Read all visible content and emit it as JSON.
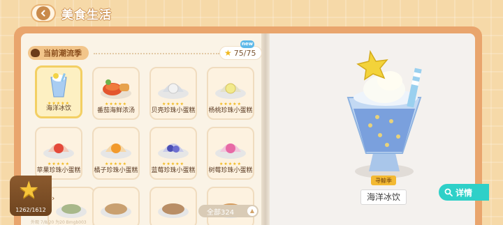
{
  "header": {
    "title": "美食生活",
    "back_icon": "chevron-left-icon"
  },
  "season": {
    "label": "当前潮流季",
    "icon": "pot-icon",
    "progress": "75/75",
    "progress_icon": "star-icon",
    "new_badge": "new"
  },
  "grid": {
    "items": [
      {
        "name": "海洋冰饮",
        "stars": "★★★★★",
        "selected": true,
        "dish": "drink"
      },
      {
        "name": "番茄海鲜浓汤",
        "stars": "★★★★★",
        "selected": false,
        "dish": "soup"
      },
      {
        "name": "贝壳珍珠小蛋糕",
        "stars": "★★★★★",
        "selected": false,
        "dish": "shell-white"
      },
      {
        "name": "杨桃珍珠小蛋糕",
        "stars": "★★★★★",
        "selected": false,
        "dish": "shell-yellow"
      },
      {
        "name": "苹果珍珠小蛋糕",
        "stars": "★★★★★",
        "selected": false,
        "dish": "shell-red"
      },
      {
        "name": "橘子珍珠小蛋糕",
        "stars": "★★★★★",
        "selected": false,
        "dish": "shell-orange"
      },
      {
        "name": "蓝莓珍珠小蛋糕",
        "stars": "★★★★★",
        "selected": false,
        "dish": "shell-blue"
      },
      {
        "name": "树莓珍珠小蛋糕",
        "stars": "★★★★★",
        "selected": false,
        "dish": "shell-pink"
      }
    ]
  },
  "collection": {
    "count": "1262/1612",
    "icon": "star-icon"
  },
  "all_button": {
    "label": "全部324",
    "icon": "chevron-up-icon"
  },
  "footer_note": "外观  7/8/20  为20  Bmgb003",
  "detail": {
    "season_label": "寻鲸季",
    "dish_name": "海洋冰饮",
    "detail_label": "详情",
    "detail_icon": "search-icon"
  }
}
